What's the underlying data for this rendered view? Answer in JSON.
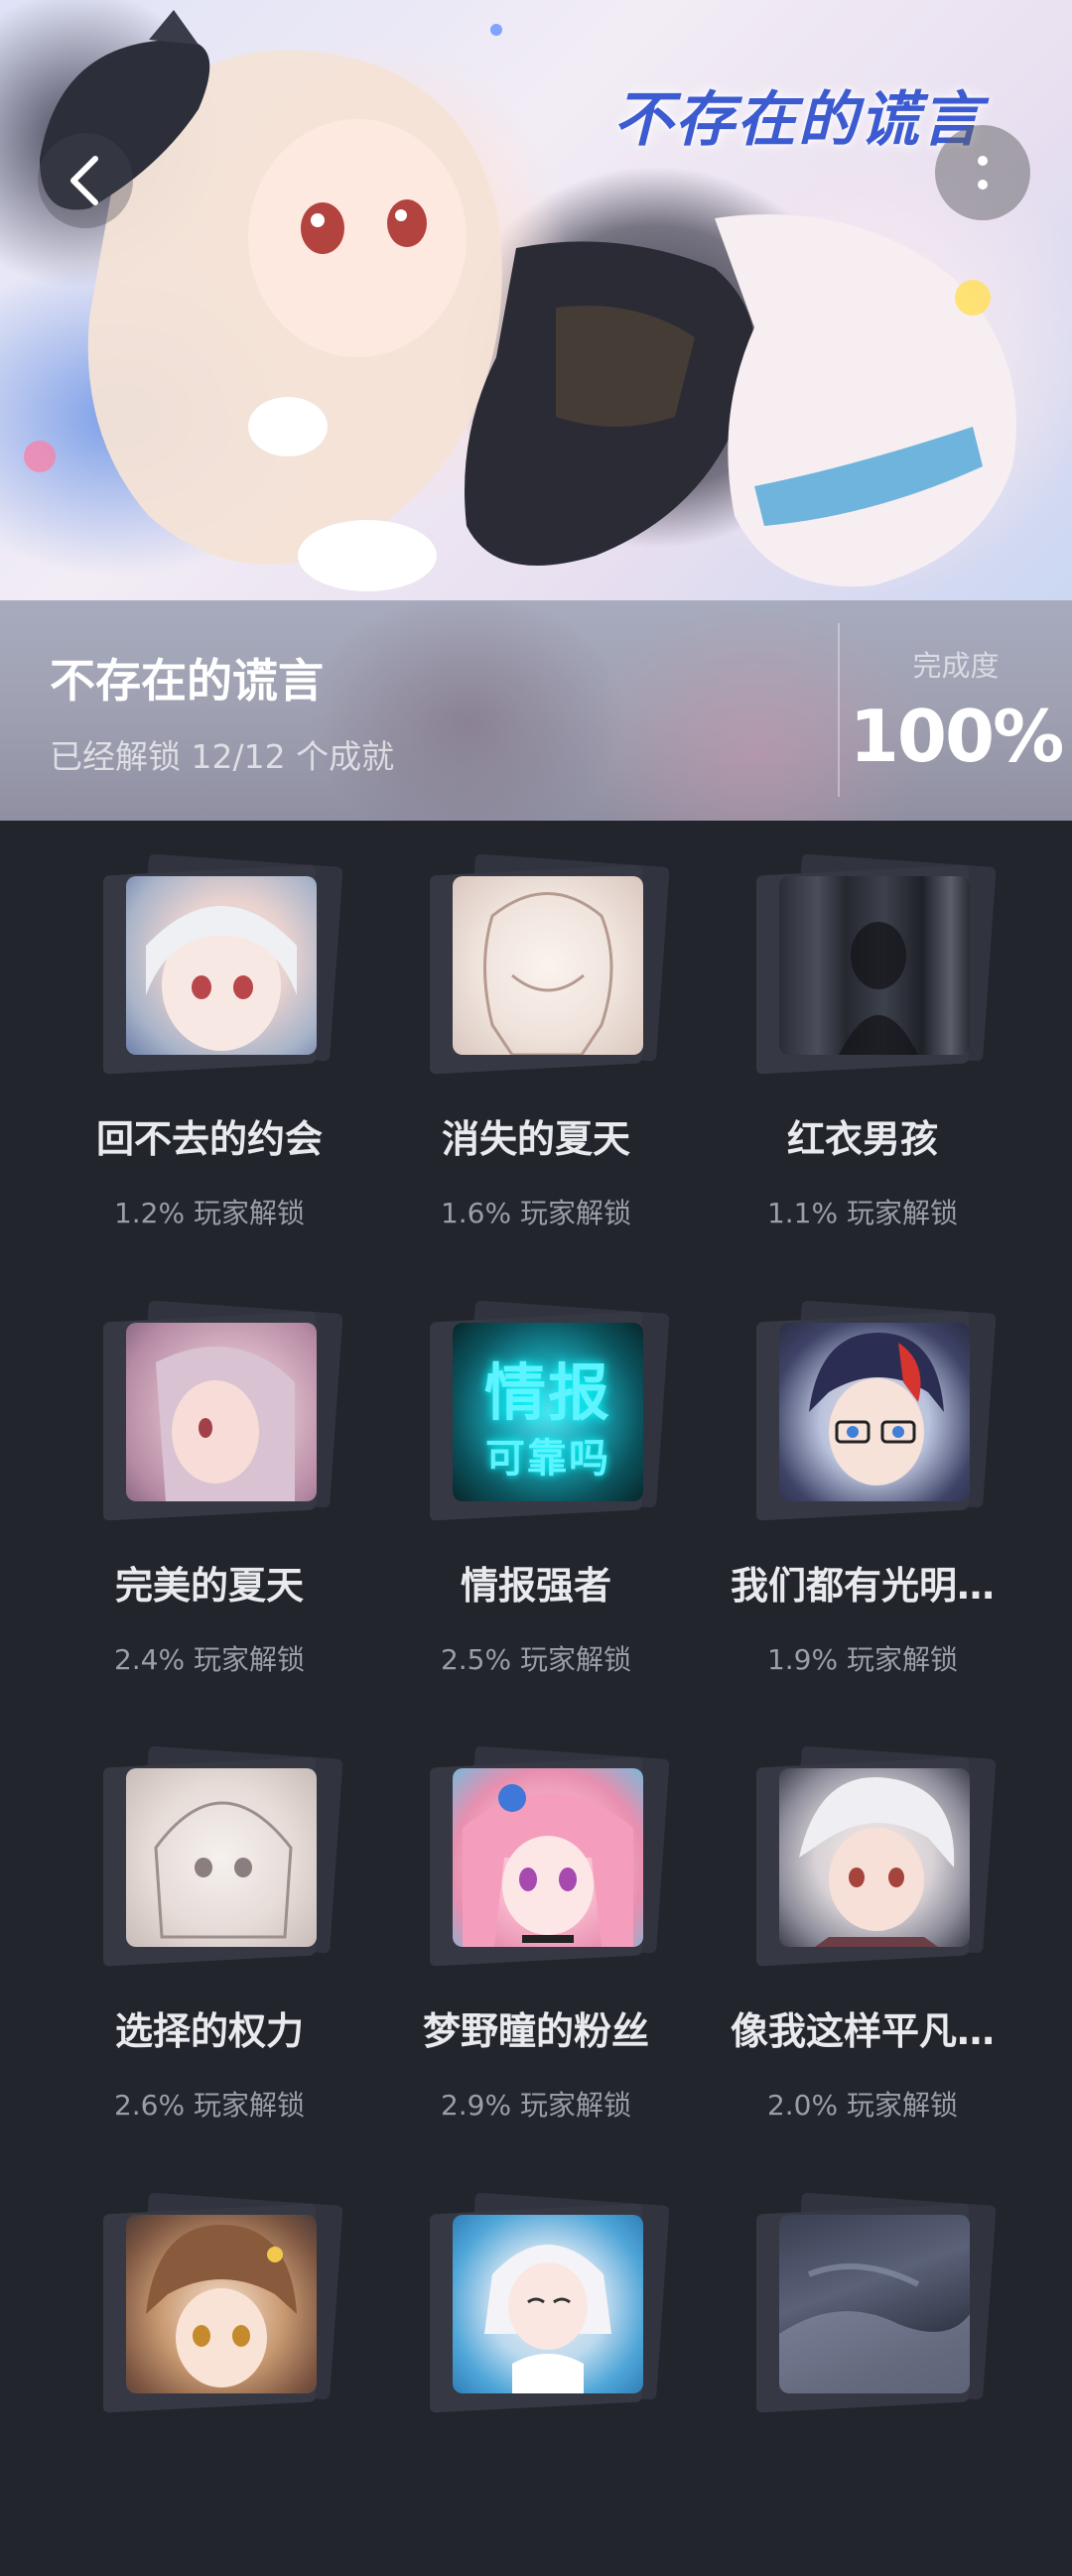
{
  "hero": {
    "title_art": "不存在的谎言",
    "back_icon": "chevron-left-icon",
    "more_icon": "more-vertical-icon"
  },
  "info": {
    "game_title": "不存在的谎言",
    "unlock_summary": "已经解锁 12/12 个成就",
    "completion_label": "完成度",
    "completion_value": "100%"
  },
  "achievements": [
    {
      "name": "回不去的约会",
      "rate": "1.2% 玩家解锁"
    },
    {
      "name": "消失的夏天",
      "rate": "1.6% 玩家解锁"
    },
    {
      "name": "红衣男孩",
      "rate": "1.1% 玩家解锁"
    },
    {
      "name": "完美的夏天",
      "rate": "2.4% 玩家解锁"
    },
    {
      "name": "情报强者",
      "rate": "2.5% 玩家解锁",
      "thumb_text_1": "情报",
      "thumb_text_2": "可靠吗"
    },
    {
      "name": "我们都有光明…",
      "rate": "1.9% 玩家解锁"
    },
    {
      "name": "选择的权力",
      "rate": "2.6% 玩家解锁"
    },
    {
      "name": "梦野瞳的粉丝",
      "rate": "2.9% 玩家解锁"
    },
    {
      "name": "像我这样平凡…",
      "rate": "2.0% 玩家解锁"
    },
    {
      "name": "",
      "rate": ""
    },
    {
      "name": "",
      "rate": ""
    },
    {
      "name": "",
      "rate": ""
    }
  ],
  "colors": {
    "page_background": "#23252d",
    "title_art": "#3d5bd0",
    "rate_text": "#9b9ea8",
    "name_text": "#e9eaee"
  }
}
